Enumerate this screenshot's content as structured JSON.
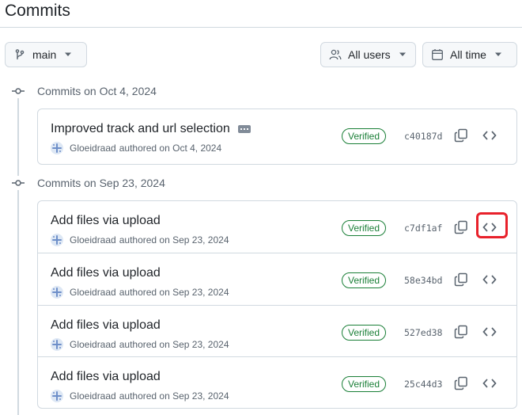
{
  "page": {
    "title": "Commits"
  },
  "filters": {
    "branch": {
      "label": "main",
      "icon": "git-branch-icon"
    },
    "users": {
      "label": "All users",
      "icon": "people-icon"
    },
    "time": {
      "label": "All time",
      "icon": "calendar-icon"
    }
  },
  "groups": [
    {
      "heading": "Commits on Oct 4, 2024",
      "commits": [
        {
          "message": "Improved track and url selection",
          "has_ellipsis": true,
          "author": "Gloeidraad",
          "authored": "authored on Oct 4, 2024",
          "badge": "Verified",
          "sha": "c40187d"
        }
      ]
    },
    {
      "heading": "Commits on Sep 23, 2024",
      "commits": [
        {
          "message": "Add files via upload",
          "author": "Gloeidraad",
          "authored": "authored on Sep 23, 2024",
          "badge": "Verified",
          "sha": "c7df1af",
          "highlighted": true
        },
        {
          "message": "Add files via upload",
          "author": "Gloeidraad",
          "authored": "authored on Sep 23, 2024",
          "badge": "Verified",
          "sha": "58e34bd"
        },
        {
          "message": "Add files via upload",
          "author": "Gloeidraad",
          "authored": "authored on Sep 23, 2024",
          "badge": "Verified",
          "sha": "527ed38"
        },
        {
          "message": "Add files via upload",
          "author": "Gloeidraad",
          "authored": "authored on Sep 23, 2024",
          "badge": "Verified",
          "sha": "25c44d3"
        }
      ]
    }
  ],
  "colors": {
    "verified": "#1a7f37",
    "highlight": "#e8212b",
    "border": "#d1d9e0",
    "muted_text": "#59636e"
  }
}
